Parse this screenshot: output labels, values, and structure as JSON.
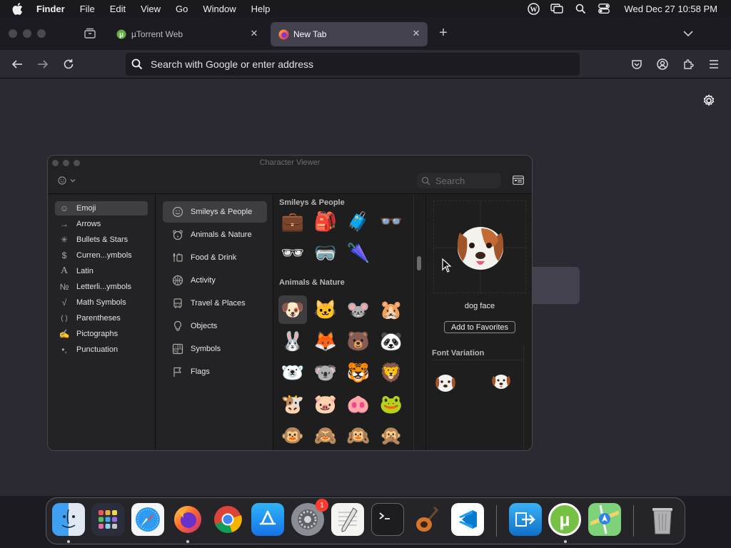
{
  "menubar": {
    "apple": "apple-icon",
    "app_name": "Finder",
    "items": [
      "File",
      "Edit",
      "View",
      "Go",
      "Window",
      "Help"
    ],
    "clock": "Wed Dec 27  10:58 PM"
  },
  "browser": {
    "tabs": [
      {
        "label": "µTorrent Web",
        "favicon": "utorrent-icon"
      },
      {
        "label": "New Tab",
        "favicon": "firefox-icon"
      }
    ],
    "url_placeholder": "Search with Google or enter address"
  },
  "char_viewer": {
    "title": "Character Viewer",
    "search_placeholder": "Search",
    "categories": [
      {
        "label": "Emoji",
        "icon": "☺"
      },
      {
        "label": "Arrows",
        "icon": "→"
      },
      {
        "label": "Bullets & Stars",
        "icon": "✳"
      },
      {
        "label": "Curren...ymbols",
        "icon": "$"
      },
      {
        "label": "Latin",
        "icon": "A"
      },
      {
        "label": "Letterli...ymbols",
        "icon": "№"
      },
      {
        "label": "Math Symbols",
        "icon": "√"
      },
      {
        "label": "Parentheses",
        "icon": "( )"
      },
      {
        "label": "Pictographs",
        "icon": "✍"
      },
      {
        "label": "Punctuation",
        "icon": "•,"
      }
    ],
    "subcategories": [
      {
        "label": "Smileys & People",
        "icon": "smiley-icon"
      },
      {
        "label": "Animals & Nature",
        "icon": "bear-icon"
      },
      {
        "label": "Food & Drink",
        "icon": "food-icon"
      },
      {
        "label": "Activity",
        "icon": "ball-icon"
      },
      {
        "label": "Travel & Places",
        "icon": "bus-icon"
      },
      {
        "label": "Objects",
        "icon": "bulb-icon"
      },
      {
        "label": "Symbols",
        "icon": "symbols-icon"
      },
      {
        "label": "Flags",
        "icon": "flag-icon"
      }
    ],
    "sections": {
      "smileys_header": "Smileys & People",
      "smileys_emoji": [
        "💼",
        "🎒",
        "🧳",
        "👓",
        "🕶",
        "🥽",
        "🌂"
      ],
      "animals_header": "Animals & Nature",
      "animals_emoji": [
        "🐶",
        "🐱",
        "🐭",
        "🐹",
        "🐰",
        "🦊",
        "🐻",
        "🐼",
        "🐻‍❄️",
        "🐨",
        "🐯",
        "🦁",
        "🐮",
        "🐷",
        "🐽",
        "🐸",
        "🐵",
        "🙈",
        "🙉",
        "🙊"
      ]
    },
    "detail": {
      "name": "dog face",
      "favorites_button": "Add to Favorites",
      "font_variation_label": "Font Variation"
    }
  },
  "dock": {
    "apps": [
      "Finder",
      "Launchpad",
      "Safari",
      "Firefox",
      "Chrome",
      "App Store",
      "System Preferences",
      "TextEdit",
      "Terminal",
      "GarageBand",
      "VS Code",
      "Migration",
      "µTorrent",
      "Maps",
      "Trash"
    ],
    "badge_count": "1"
  }
}
